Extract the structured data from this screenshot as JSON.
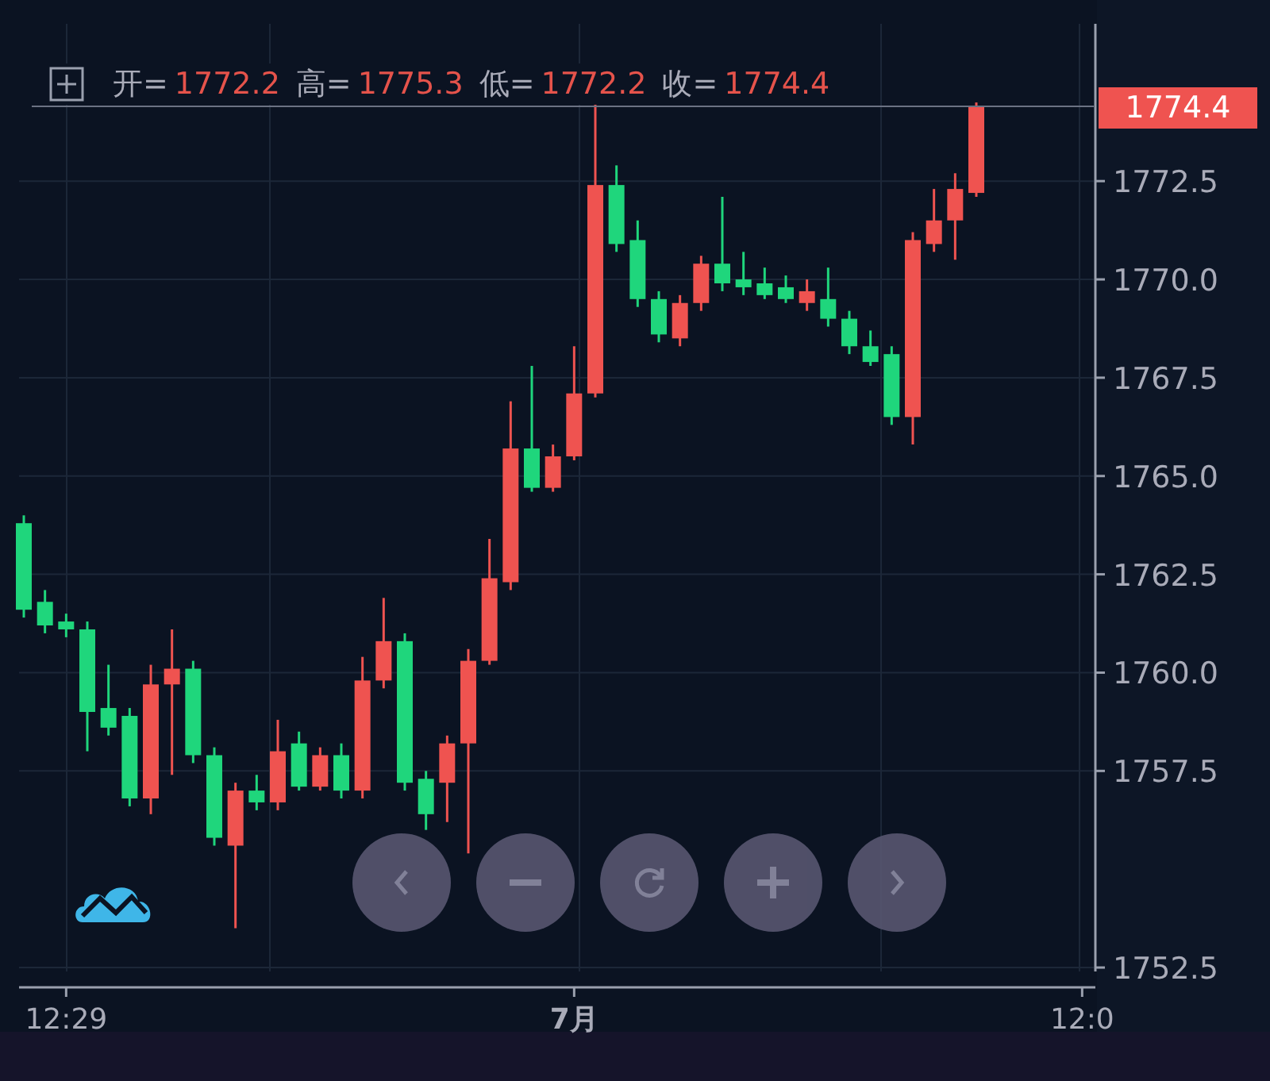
{
  "legend": [
    {
      "label": "开=",
      "value": "1772.2"
    },
    {
      "label": "高=",
      "value": "1775.3"
    },
    {
      "label": "低=",
      "value": "1772.2"
    },
    {
      "label": "收=",
      "value": "1774.4"
    }
  ],
  "chart": {
    "current_price": "1774.4",
    "chart_data": {
      "type": "candlestick",
      "ylim": [
        1752.4,
        1776.5
      ],
      "grid": true,
      "ref_lines": [
        {
          "axis": "y",
          "value": 1774.4
        }
      ],
      "categories": [
        null,
        null,
        "12:29",
        null,
        null,
        null,
        null,
        null,
        null,
        null,
        null,
        null,
        null,
        null,
        null,
        null,
        null,
        null,
        null,
        null,
        null,
        null,
        null,
        null,
        null,
        null,
        "7月",
        null,
        null,
        null,
        null,
        null,
        null,
        null,
        null,
        null,
        null,
        null,
        null,
        null,
        null,
        null,
        null,
        null,
        null,
        null,
        null,
        null,
        null,
        null,
        "12:0"
      ],
      "yticks": [
        {
          "value": 1772.5,
          "label": "1772.5"
        },
        {
          "value": 1770,
          "label": "1770.0"
        },
        {
          "value": 1767.5,
          "label": "1767.5"
        },
        {
          "value": 1765,
          "label": "1765.0"
        },
        {
          "value": 1762.5,
          "label": "1762.5"
        },
        {
          "value": 1760,
          "label": "1760.0"
        },
        {
          "value": 1757.5,
          "label": "1757.5"
        },
        {
          "value": 1752.5,
          "label": "1752.5"
        }
      ],
      "ohlc": [
        [
          1763.8,
          1764.0,
          1761.4,
          1761.6
        ],
        [
          1761.8,
          1762.1,
          1761.0,
          1761.2
        ],
        [
          1761.3,
          1761.5,
          1760.9,
          1761.1
        ],
        [
          1761.1,
          1761.3,
          1758.0,
          1759.0
        ],
        [
          1759.1,
          1760.2,
          1758.4,
          1758.6
        ],
        [
          1758.9,
          1759.1,
          1756.6,
          1756.8
        ],
        [
          1756.8,
          1760.2,
          1756.4,
          1759.7
        ],
        [
          1759.7,
          1761.1,
          1757.4,
          1760.1
        ],
        [
          1760.1,
          1760.3,
          1757.7,
          1757.9
        ],
        [
          1757.9,
          1758.1,
          1755.6,
          1755.8
        ],
        [
          1755.6,
          1757.2,
          1753.5,
          1757.0
        ],
        [
          1757.0,
          1757.4,
          1756.5,
          1756.7
        ],
        [
          1756.7,
          1758.8,
          1756.5,
          1758.0
        ],
        [
          1758.2,
          1758.5,
          1757.0,
          1757.1
        ],
        [
          1757.1,
          1758.1,
          1757.0,
          1757.9
        ],
        [
          1757.9,
          1758.2,
          1756.8,
          1757.0
        ],
        [
          1757.0,
          1760.4,
          1756.8,
          1759.8
        ],
        [
          1759.8,
          1761.9,
          1759.6,
          1760.8
        ],
        [
          1760.8,
          1761.0,
          1757.0,
          1757.2
        ],
        [
          1757.3,
          1757.5,
          1756.0,
          1756.4
        ],
        [
          1757.2,
          1758.4,
          1756.2,
          1758.2
        ],
        [
          1758.2,
          1760.6,
          1755.4,
          1760.3
        ],
        [
          1760.3,
          1763.4,
          1760.2,
          1762.4
        ],
        [
          1762.3,
          1766.9,
          1762.1,
          1765.7
        ],
        [
          1765.7,
          1767.8,
          1764.6,
          1764.7
        ],
        [
          1764.7,
          1765.8,
          1764.6,
          1765.5
        ],
        [
          1765.5,
          1768.3,
          1765.4,
          1767.1
        ],
        [
          1767.1,
          1774.5,
          1767.0,
          1772.4
        ],
        [
          1772.4,
          1772.9,
          1770.7,
          1770.9
        ],
        [
          1771.0,
          1771.5,
          1769.3,
          1769.5
        ],
        [
          1769.5,
          1769.7,
          1768.4,
          1768.6
        ],
        [
          1768.5,
          1769.6,
          1768.3,
          1769.4
        ],
        [
          1769.4,
          1770.6,
          1769.2,
          1770.4
        ],
        [
          1770.4,
          1772.1,
          1769.7,
          1769.9
        ],
        [
          1770.0,
          1770.7,
          1769.6,
          1769.8
        ],
        [
          1769.9,
          1770.3,
          1769.5,
          1769.6
        ],
        [
          1769.8,
          1770.1,
          1769.4,
          1769.5
        ],
        [
          1769.4,
          1770.0,
          1769.2,
          1769.7
        ],
        [
          1769.5,
          1770.3,
          1768.8,
          1769.0
        ],
        [
          1769.0,
          1769.2,
          1768.1,
          1768.3
        ],
        [
          1768.3,
          1768.7,
          1767.8,
          1767.9
        ],
        [
          1768.1,
          1768.3,
          1766.3,
          1766.5
        ],
        [
          1766.5,
          1771.2,
          1765.8,
          1771.0
        ],
        [
          1770.9,
          1772.3,
          1770.7,
          1771.5
        ],
        [
          1771.5,
          1772.7,
          1770.5,
          1772.3
        ],
        [
          1772.2,
          1774.5,
          1772.1,
          1774.4
        ],
        null,
        null,
        null,
        null,
        null
      ]
    }
  }
}
